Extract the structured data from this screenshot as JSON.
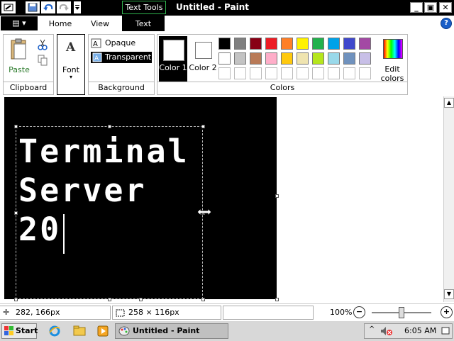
{
  "titlebar": {
    "context_tab": "Text Tools",
    "title": "Untitled - Paint",
    "minimize": "_",
    "maximize": "▣",
    "close": "✕"
  },
  "tabs": {
    "menu_label": "▤ ▾",
    "home": "Home",
    "view": "View",
    "text": "Text",
    "help": "?"
  },
  "ribbon": {
    "clipboard": {
      "paste": "Paste",
      "label": "Clipboard"
    },
    "font": {
      "font": "Font",
      "font_arrow": "▾"
    },
    "background": {
      "opaque": "Opaque",
      "transparent": "Transparent",
      "label": "Background"
    },
    "colors": {
      "color1": "Color 1",
      "color2": "Color 2",
      "edit": "Edit colors",
      "label": "Colors",
      "palette_row1": [
        "#000000",
        "#7f7f7f",
        "#880015",
        "#ed1c24",
        "#ff7f27",
        "#fff200",
        "#22b14c",
        "#00a2e8",
        "#3f48cc",
        "#a349a4"
      ],
      "palette_row2": [
        "#ffffff",
        "#c3c3c3",
        "#b97a57",
        "#ffaec9",
        "#ffc90e",
        "#efe4b0",
        "#b5e61d",
        "#99d9ea",
        "#7092be",
        "#c8bfe7"
      ],
      "palette_row3": [
        "#ffffff",
        "#ffffff",
        "#ffffff",
        "#ffffff",
        "#ffffff",
        "#ffffff",
        "#ffffff",
        "#ffffff",
        "#ffffff",
        "#ffffff"
      ]
    }
  },
  "canvas": {
    "text_lines": [
      "Terminal",
      "Server",
      "20"
    ]
  },
  "status": {
    "cursor_pos": "282, 166px",
    "selection_size": "258 × 116px",
    "zoom": "100%",
    "zoom_level": 0.5
  },
  "taskbar": {
    "start": "Start",
    "task": "Untitled - Paint",
    "time": "6:05 AM"
  }
}
